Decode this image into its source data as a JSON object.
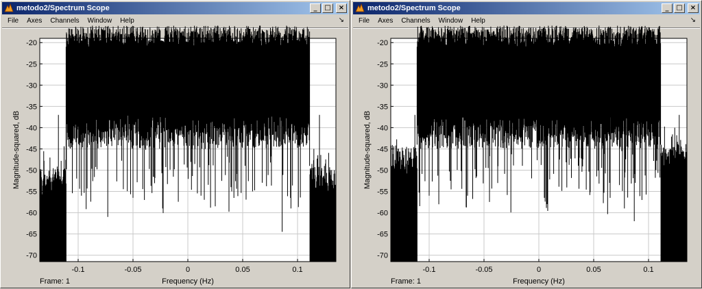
{
  "windows": [
    {
      "title": "metodo2/Spectrum Scope",
      "menu": [
        "File",
        "Axes",
        "Channels",
        "Window",
        "Help"
      ],
      "dock_icon": "dock-arrow-icon",
      "frame_label": "Frame: 1",
      "plot": {
        "xlabel": "Frequency (Hz)",
        "ylabel": "Magnitude-squared, dB",
        "xticks": [
          "-0.1",
          "-0.05",
          "0",
          "0.05",
          "0.1"
        ],
        "yticks": [
          "-20",
          "-25",
          "-30",
          "-35",
          "-40",
          "-45",
          "-50",
          "-55",
          "-60",
          "-65",
          "-70"
        ]
      }
    },
    {
      "title": "metodo2/Spectrum Scope",
      "menu": [
        "File",
        "Axes",
        "Channels",
        "Window",
        "Help"
      ],
      "dock_icon": "dock-arrow-icon",
      "frame_label": "Frame: 1",
      "plot": {
        "xlabel": "Frequency (Hz)",
        "ylabel": "Magnitude-squared, dB",
        "xticks": [
          "-0.1",
          "-0.05",
          "0",
          "0.05",
          "0.1"
        ],
        "yticks": [
          "-20",
          "-25",
          "-30",
          "-35",
          "-40",
          "-45",
          "-50",
          "-55",
          "-60",
          "-65",
          "-70"
        ]
      }
    }
  ],
  "chart_data": [
    {
      "type": "line",
      "xlim": [
        -0.135,
        0.135
      ],
      "ylim": [
        -71.5,
        -19
      ],
      "grid": true,
      "passband": [
        -0.111,
        0.111
      ],
      "passband_top_db": -21,
      "passband_bottom_db": -37,
      "stopband_top_db": -49,
      "stopband_bottom_db": -71.5,
      "spikes_db": [
        {
          "x": -0.118,
          "y": -60.5
        },
        {
          "x": -0.097,
          "y": -56
        },
        {
          "x": -0.073,
          "y": -61
        },
        {
          "x": -0.05,
          "y": -56.5
        },
        {
          "x": -0.023,
          "y": -59
        },
        {
          "x": 0.012,
          "y": -56
        },
        {
          "x": 0.025,
          "y": -58.5
        },
        {
          "x": 0.04,
          "y": -55
        },
        {
          "x": 0.059,
          "y": -55
        },
        {
          "x": 0.086,
          "y": -64.5
        },
        {
          "x": 0.094,
          "y": -59
        },
        {
          "x": 0.12,
          "y": -62
        }
      ]
    },
    {
      "type": "line",
      "xlim": [
        -0.135,
        0.135
      ],
      "ylim": [
        -71.5,
        -19
      ],
      "grid": true,
      "passband": [
        -0.111,
        0.111
      ],
      "passband_top_db": -21,
      "passband_bottom_db": -37,
      "stopband_top_db": -44,
      "stopband_bottom_db": -71.5,
      "spikes_db": [
        {
          "x": -0.113,
          "y": -66
        },
        {
          "x": -0.1,
          "y": -56
        },
        {
          "x": -0.08,
          "y": -54.5
        },
        {
          "x": -0.065,
          "y": -56
        },
        {
          "x": 0.005,
          "y": -56.5
        },
        {
          "x": 0.065,
          "y": -56.5
        },
        {
          "x": 0.078,
          "y": -59
        },
        {
          "x": 0.087,
          "y": -62
        },
        {
          "x": 0.094,
          "y": -57
        },
        {
          "x": 0.128,
          "y": -69
        }
      ]
    }
  ]
}
